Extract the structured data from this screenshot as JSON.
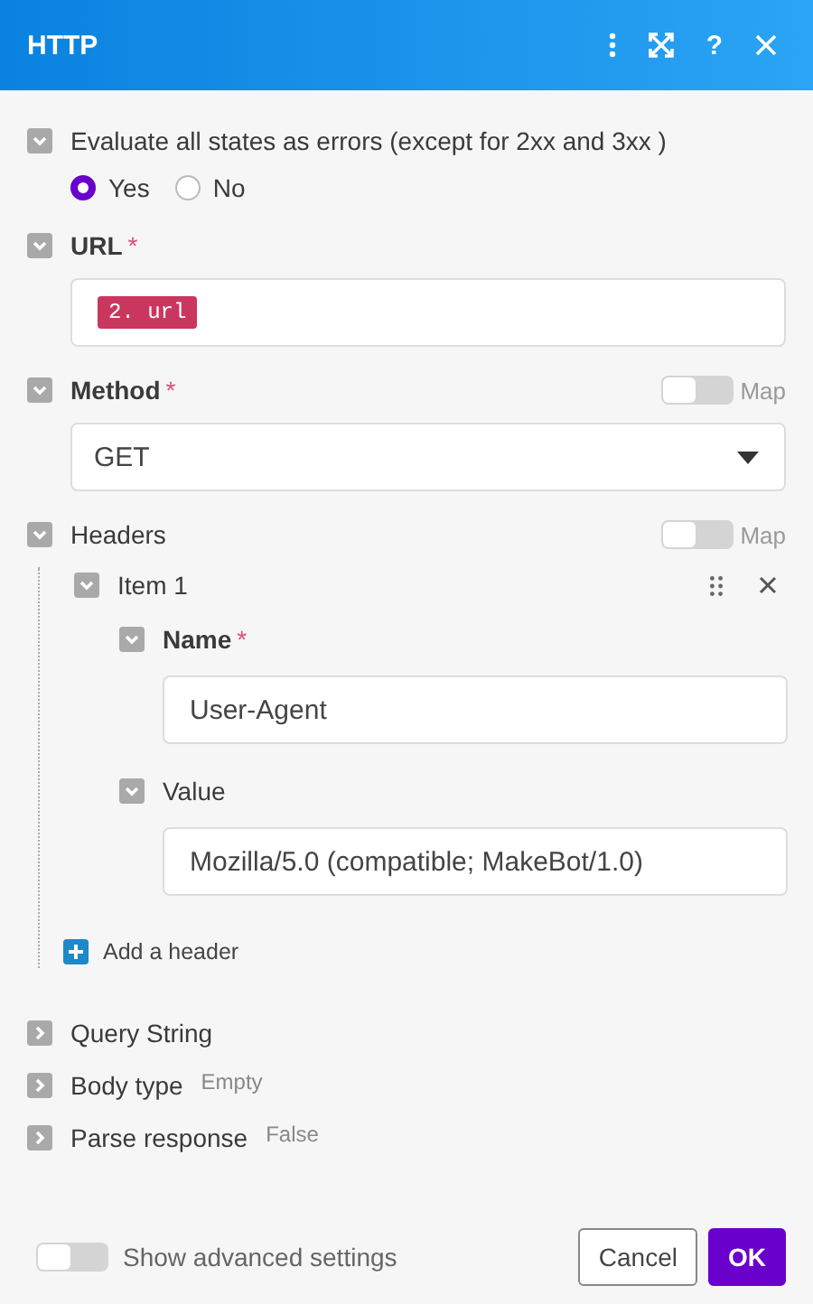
{
  "window": {
    "title": "HTTP",
    "help": "?"
  },
  "evaluate_errors": {
    "label": "Evaluate all states as errors (except for 2xx and 3xx )",
    "expanded": true,
    "options": [
      {
        "label": "Yes",
        "selected": true
      },
      {
        "label": "No",
        "selected": false
      }
    ]
  },
  "url": {
    "label": "URL",
    "required": true,
    "required_mark": "*",
    "expanded": true,
    "token": "2. url"
  },
  "method": {
    "label": "Method",
    "required": true,
    "required_mark": "*",
    "expanded": true,
    "map": {
      "label": "Map",
      "on": false
    },
    "value": "GET"
  },
  "headers": {
    "label": "Headers",
    "required": false,
    "expanded": true,
    "map": {
      "label": "Map",
      "on": false
    },
    "items": [
      {
        "label": "Item 1",
        "expanded": true,
        "fields": [
          {
            "label": "Name",
            "required": true,
            "required_mark": "*",
            "expanded": true,
            "value": "User-Agent"
          },
          {
            "label": "Value",
            "required": false,
            "expanded": true,
            "value": "Mozilla/5.0 (compatible; MakeBot/1.0)"
          }
        ]
      }
    ],
    "add_label": "Add a header"
  },
  "collapsed_sections": [
    {
      "label": "Query String",
      "expanded": false
    },
    {
      "label": "Body type",
      "expanded": false,
      "hint": "Empty"
    },
    {
      "label": "Parse response",
      "expanded": false,
      "hint": "False"
    }
  ],
  "footer": {
    "advanced": {
      "label": "Show advanced settings",
      "on": false
    },
    "buttons": [
      {
        "label": "Cancel",
        "kind": "secondary"
      },
      {
        "label": "OK",
        "kind": "primary"
      }
    ]
  }
}
